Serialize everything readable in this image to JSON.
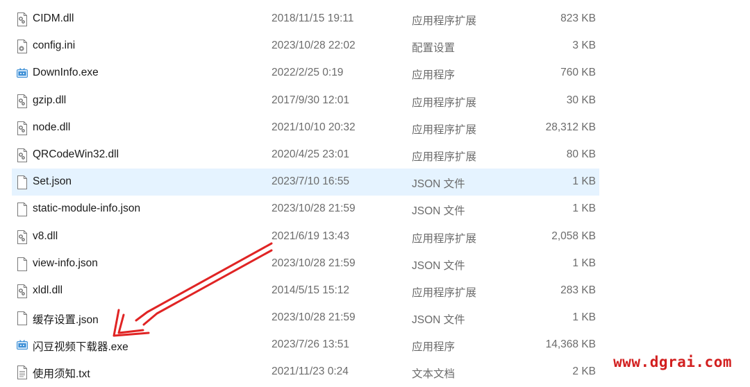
{
  "files": [
    {
      "name": "CIDM.dll",
      "date": "2018/11/15 19:11",
      "type": "应用程序扩展",
      "size": "823 KB",
      "icon": "dll-icon"
    },
    {
      "name": "config.ini",
      "date": "2023/10/28 22:02",
      "type": "配置设置",
      "size": "3 KB",
      "icon": "ini-icon"
    },
    {
      "name": "DownInfo.exe",
      "date": "2022/2/25 0:19",
      "type": "应用程序",
      "size": "760 KB",
      "icon": "exe-icon"
    },
    {
      "name": "gzip.dll",
      "date": "2017/9/30 12:01",
      "type": "应用程序扩展",
      "size": "30 KB",
      "icon": "dll-icon"
    },
    {
      "name": "node.dll",
      "date": "2021/10/10 20:32",
      "type": "应用程序扩展",
      "size": "28,312 KB",
      "icon": "dll-icon"
    },
    {
      "name": "QRCodeWin32.dll",
      "date": "2020/4/25 23:01",
      "type": "应用程序扩展",
      "size": "80 KB",
      "icon": "dll-icon"
    },
    {
      "name": "Set.json",
      "date": "2023/7/10 16:55",
      "type": "JSON 文件",
      "size": "1 KB",
      "icon": "file-icon",
      "selected": true
    },
    {
      "name": "static-module-info.json",
      "date": "2023/10/28 21:59",
      "type": "JSON 文件",
      "size": "1 KB",
      "icon": "file-icon"
    },
    {
      "name": "v8.dll",
      "date": "2021/6/19 13:43",
      "type": "应用程序扩展",
      "size": "2,058 KB",
      "icon": "dll-icon"
    },
    {
      "name": "view-info.json",
      "date": "2023/10/28 21:59",
      "type": "JSON 文件",
      "size": "1 KB",
      "icon": "file-icon"
    },
    {
      "name": "xldl.dll",
      "date": "2014/5/15 15:12",
      "type": "应用程序扩展",
      "size": "283 KB",
      "icon": "dll-icon"
    },
    {
      "name": "缓存设置.json",
      "date": "2023/10/28 21:59",
      "type": "JSON 文件",
      "size": "1 KB",
      "icon": "file-icon"
    },
    {
      "name": "闪豆视频下载器.exe",
      "date": "2023/7/26 13:51",
      "type": "应用程序",
      "size": "14,368 KB",
      "icon": "exe-icon"
    },
    {
      "name": "使用须知.txt",
      "date": "2021/11/23 0:24",
      "type": "文本文档",
      "size": "2 KB",
      "icon": "txt-icon"
    }
  ],
  "watermark": "www.dgrai.com",
  "colors": {
    "selected_row": "#e5f3ff",
    "arrow": "#e02424",
    "watermark": "#d21f1f",
    "secondary_text": "#6b6b6b"
  }
}
